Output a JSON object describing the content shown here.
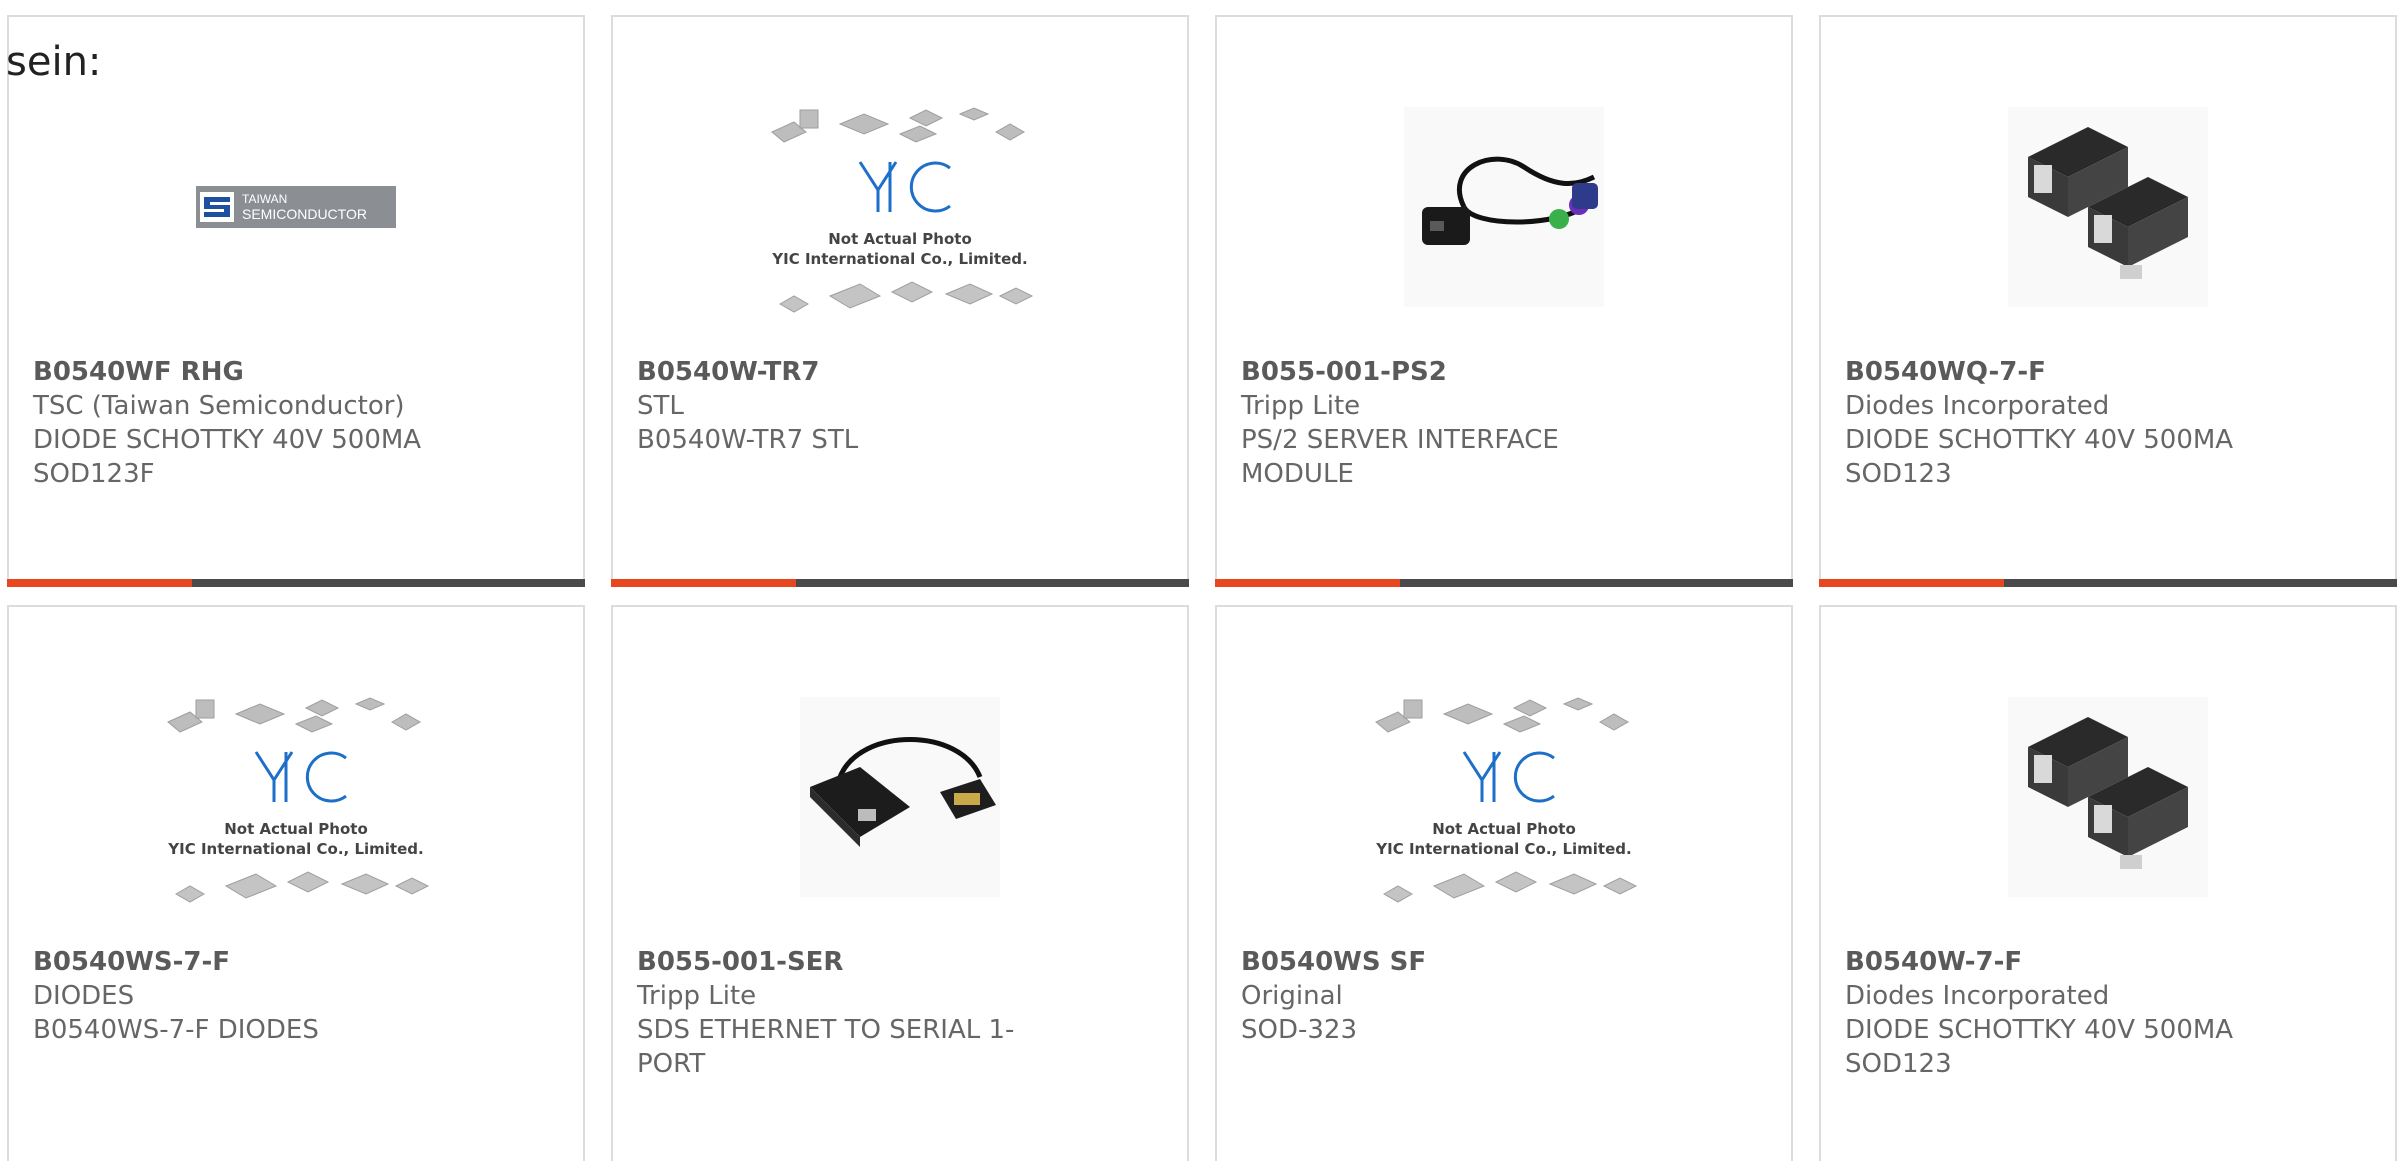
{
  "heading": "sein:",
  "colors": {
    "accent": "#e8461e",
    "track": "#4a4a4a",
    "card_border": "#dcdcdc",
    "title_text": "#5a5a5a",
    "body_text": "#666666"
  },
  "products": [
    {
      "part_no": "B0540WF RHG",
      "maker": "TSC (Taiwan Semiconductor)",
      "desc": "DIODE SCHOTTKY 40V 500MA SOD123F",
      "image": "taiwan-semiconductor-logo",
      "logo_text_1": "TAIWAN",
      "logo_text_2": "SEMICONDUCTOR",
      "progress_fraction": 0.32
    },
    {
      "part_no": "B0540W-TR7",
      "maker": "STL",
      "desc": "B0540W-TR7 STL",
      "image": "not-actual-photo-placeholder",
      "placeholder_line_1": "Not Actual Photo",
      "placeholder_line_2": "YIC International Co., Limited.",
      "progress_fraction": 0.32
    },
    {
      "part_no": "B055-001-PS2",
      "maker": "Tripp Lite",
      "desc": "PS/2 SERVER INTERFACE MODULE",
      "image": "ps2-interface-cable-photo",
      "progress_fraction": 0.32
    },
    {
      "part_no": "B0540WQ-7-F",
      "maker": "Diodes Incorporated",
      "desc": "DIODE SCHOTTKY 40V 500MA SOD123",
      "image": "sod123-diode-photo",
      "progress_fraction": 0.32
    },
    {
      "part_no": "B0540WS-7-F",
      "maker": "DIODES",
      "desc": "B0540WS-7-F DIODES",
      "image": "not-actual-photo-placeholder",
      "placeholder_line_1": "Not Actual Photo",
      "placeholder_line_2": "YIC International Co., Limited."
    },
    {
      "part_no": "B055-001-SER",
      "maker": "Tripp Lite",
      "desc": "SDS ETHERNET TO SERIAL 1-PORT",
      "image": "serial-interface-cable-photo"
    },
    {
      "part_no": "B0540WS SF",
      "maker": "Original",
      "desc": "SOD-323",
      "image": "not-actual-photo-placeholder",
      "placeholder_line_1": "Not Actual Photo",
      "placeholder_line_2": "YIC International Co., Limited."
    },
    {
      "part_no": "B0540W-7-F",
      "maker": "Diodes Incorporated",
      "desc": "DIODE SCHOTTKY 40V 500MA SOD123",
      "image": "sod123-diode-photo"
    }
  ]
}
